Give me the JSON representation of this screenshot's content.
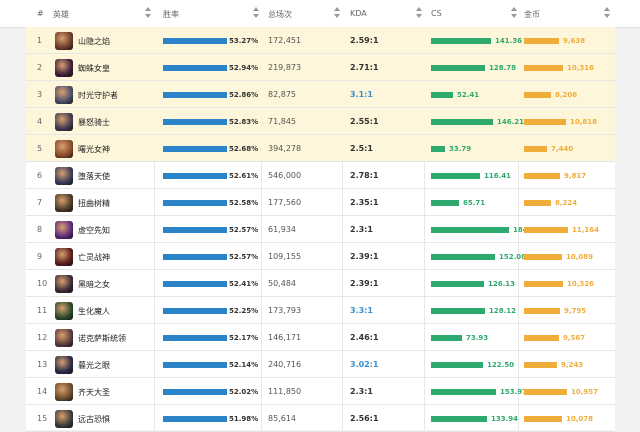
{
  "header": {
    "num": "#",
    "hero": "英雄",
    "winrate": "胜率",
    "games": "总场次",
    "kda": "KDA",
    "cs": "CS",
    "gold": "金币"
  },
  "colors": {
    "winrate_bar": "#2b84c7",
    "cs_bar": "#2eaa6e",
    "gold_bar": "#f0ad3a",
    "kda_dark": "#333333",
    "kda_blue": "#3a8fd0",
    "highlight": "#fdf6da"
  },
  "rows": [
    {
      "num": "1",
      "name": "山隐之焰",
      "winrate": "53.27%",
      "winrate_pct": 53.27,
      "games": "172,451",
      "kda": "2.59:1",
      "kda_color": "dark",
      "cs": "141.36",
      "gold": "9,638",
      "highlight": true,
      "avatar": "#6b3a2a"
    },
    {
      "num": "2",
      "name": "蜘蛛女皇",
      "winrate": "52.94%",
      "winrate_pct": 52.94,
      "games": "219,873",
      "kda": "2.71:1",
      "kda_color": "dark",
      "cs": "128.78",
      "gold": "10,316",
      "highlight": true,
      "avatar": "#3a1f3a"
    },
    {
      "num": "3",
      "name": "时光守护者",
      "winrate": "52.86%",
      "winrate_pct": 52.86,
      "games": "82,875",
      "kda": "3.1:1",
      "kda_color": "blue",
      "cs": "52.41",
      "gold": "8,206",
      "highlight": true,
      "avatar": "#4a4e6a"
    },
    {
      "num": "4",
      "name": "暴怒骑士",
      "winrate": "52.83%",
      "winrate_pct": 52.83,
      "games": "71,845",
      "kda": "2.55:1",
      "kda_color": "dark",
      "cs": "146.21",
      "gold": "10,818",
      "highlight": true,
      "avatar": "#3d3a50"
    },
    {
      "num": "5",
      "name": "曙光女神",
      "winrate": "52.68%",
      "winrate_pct": 52.68,
      "games": "394,278",
      "kda": "2.5:1",
      "kda_color": "dark",
      "cs": "33.79",
      "gold": "7,440",
      "highlight": true,
      "avatar": "#8a4a2a"
    },
    {
      "num": "6",
      "name": "堕落天使",
      "winrate": "52.61%",
      "winrate_pct": 52.61,
      "games": "546,000",
      "kda": "2.78:1",
      "kda_color": "dark",
      "cs": "116.41",
      "gold": "9,817",
      "highlight": false,
      "avatar": "#3a3a5a"
    },
    {
      "num": "7",
      "name": "扭曲树精",
      "winrate": "52.58%",
      "winrate_pct": 52.58,
      "games": "177,560",
      "kda": "2.35:1",
      "kda_color": "dark",
      "cs": "65.71",
      "gold": "8,224",
      "highlight": false,
      "avatar": "#4a3a2a"
    },
    {
      "num": "8",
      "name": "虚空先知",
      "winrate": "52.57%",
      "winrate_pct": 52.57,
      "games": "61,934",
      "kda": "2.3:1",
      "kda_color": "dark",
      "cs": "184.89",
      "gold": "11,164",
      "highlight": false,
      "avatar": "#5a2a7a"
    },
    {
      "num": "9",
      "name": "亡灵战神",
      "winrate": "52.57%",
      "winrate_pct": 52.57,
      "games": "109,155",
      "kda": "2.39:1",
      "kda_color": "dark",
      "cs": "152.08",
      "gold": "10,089",
      "highlight": false,
      "avatar": "#5a1a1a"
    },
    {
      "num": "10",
      "name": "黑暗之女",
      "winrate": "52.41%",
      "winrate_pct": 52.41,
      "games": "50,484",
      "kda": "2.39:1",
      "kda_color": "dark",
      "cs": "126.13",
      "gold": "10,326",
      "highlight": false,
      "avatar": "#3a2a3a"
    },
    {
      "num": "11",
      "name": "生化魔人",
      "winrate": "52.25%",
      "winrate_pct": 52.25,
      "games": "173,793",
      "kda": "3.3:1",
      "kda_color": "blue",
      "cs": "128.12",
      "gold": "9,795",
      "highlight": false,
      "avatar": "#2a4a2a"
    },
    {
      "num": "12",
      "name": "诺克萨斯统领",
      "winrate": "52.17%",
      "winrate_pct": 52.17,
      "games": "146,171",
      "kda": "2.46:1",
      "kda_color": "dark",
      "cs": "73.93",
      "gold": "9,567",
      "highlight": false,
      "avatar": "#5a3a3a"
    },
    {
      "num": "13",
      "name": "暮光之眼",
      "winrate": "52.14%",
      "winrate_pct": 52.14,
      "games": "240,716",
      "kda": "3.02:1",
      "kda_color": "blue",
      "cs": "122.50",
      "gold": "9,243",
      "highlight": false,
      "avatar": "#2a2a4a"
    },
    {
      "num": "14",
      "name": "齐天大圣",
      "winrate": "52.02%",
      "winrate_pct": 52.02,
      "games": "111,850",
      "kda": "2.3:1",
      "kda_color": "dark",
      "cs": "153.97",
      "gold": "10,957",
      "highlight": false,
      "avatar": "#6a4a2a"
    },
    {
      "num": "15",
      "name": "远古恐惧",
      "winrate": "51.98%",
      "winrate_pct": 51.98,
      "games": "85,614",
      "kda": "2.56:1",
      "kda_color": "dark",
      "cs": "133.94",
      "gold": "10,078",
      "highlight": false,
      "avatar": "#3a3a3a"
    }
  ]
}
